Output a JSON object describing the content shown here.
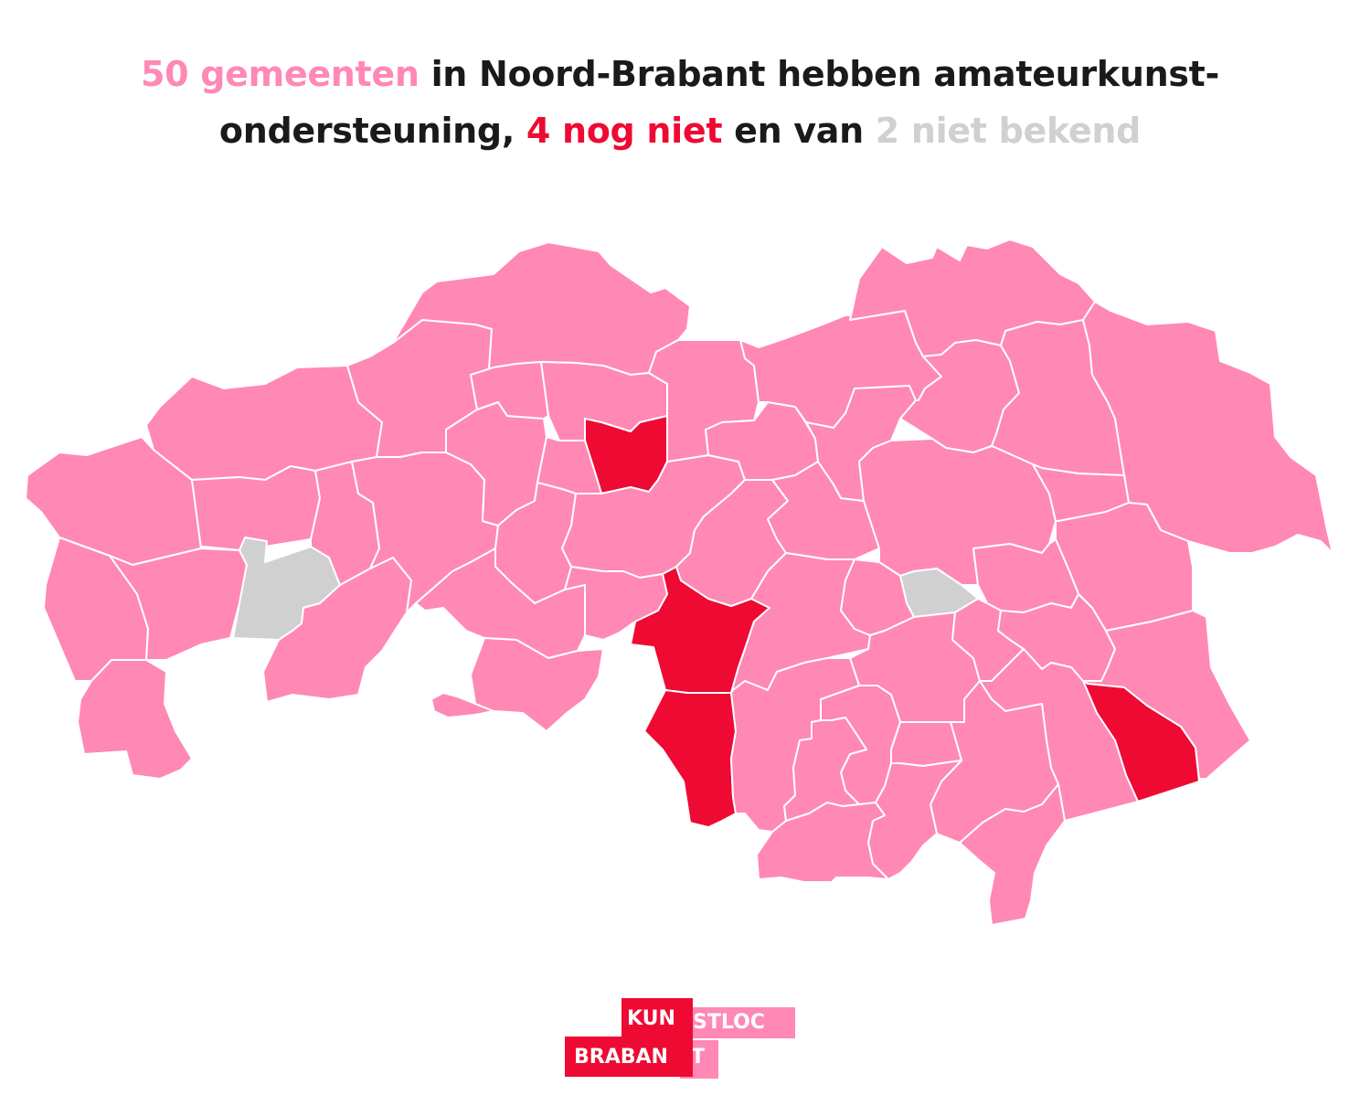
{
  "title": {
    "line1": {
      "count_with": "50 gemeenten",
      "rest": " in Noord-Brabant hebben amateurkunst-"
    },
    "line2": {
      "start": "ondersteuning, ",
      "count_without": "4 nog niet",
      "middle": " en van ",
      "count_unknown": "2 niet bekend"
    }
  },
  "colors": {
    "with_support": "#ff88b5",
    "without_support": "#ee0a33",
    "unknown": "#d0d0d0",
    "border": "#ffffff",
    "text": "#1a1a1a"
  },
  "legend_counts": {
    "with_support": 50,
    "without_support": 4,
    "unknown": 2
  },
  "logo": {
    "top_left": "KUN",
    "top_right": "STLOC",
    "bottom_left": "BRABAN",
    "bottom_right": "T",
    "red": "#ee0a33",
    "pink": "#ff88b5"
  }
}
